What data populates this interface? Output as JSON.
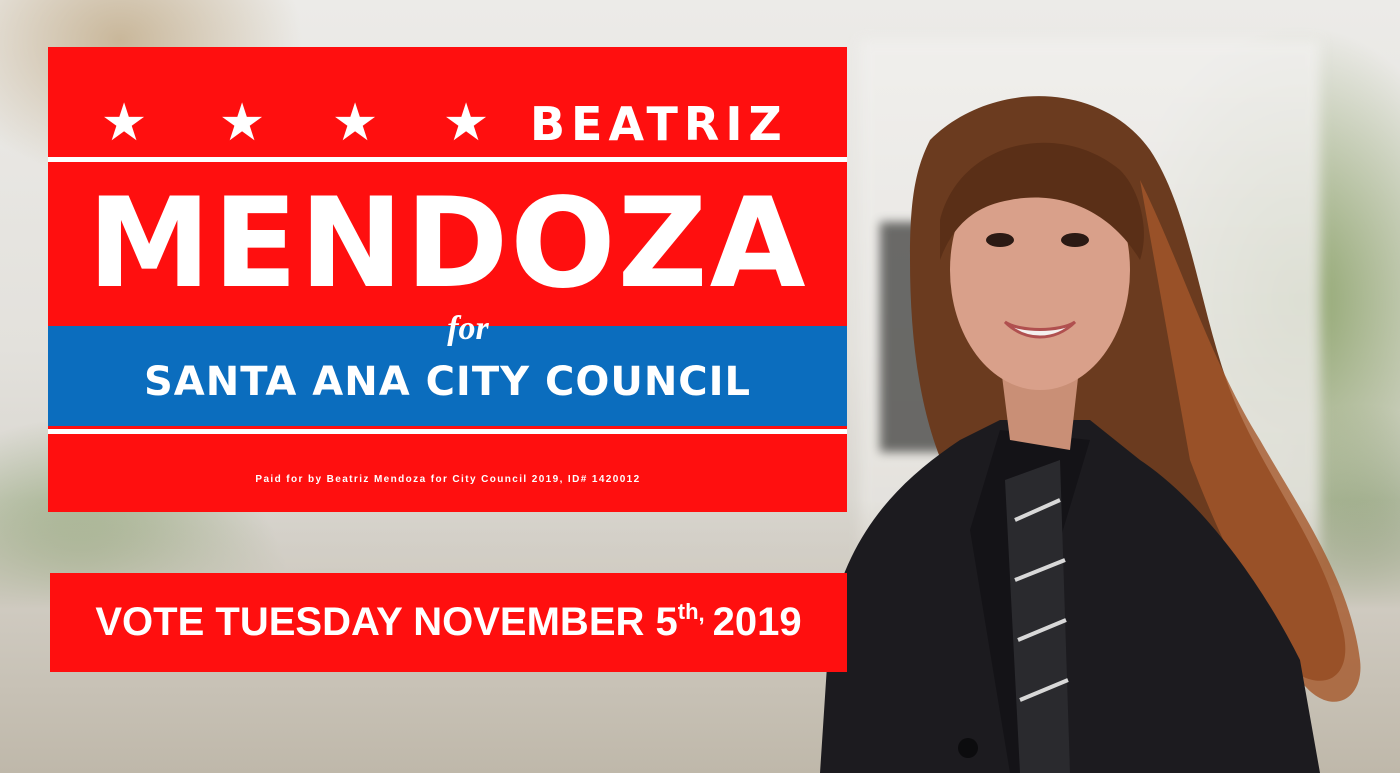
{
  "sign": {
    "stars": [
      "★",
      "★",
      "★",
      "★"
    ],
    "first_name": "BEATRIZ",
    "last_name": "MENDOZA",
    "for_word": "for",
    "office": "SANTA ANA CITY COUNCIL",
    "disclaimer": "Paid for by Beatriz Mendoza for City Council 2019, ID# 1420012",
    "colors": {
      "red": "#ff0f0f",
      "blue": "#0b6dbe",
      "white": "#ffffff"
    }
  },
  "vote_banner": {
    "text_main": "VOTE TUESDAY NOVEMBER 5",
    "ordinal": "th",
    "comma": ",",
    "year": "2019"
  }
}
